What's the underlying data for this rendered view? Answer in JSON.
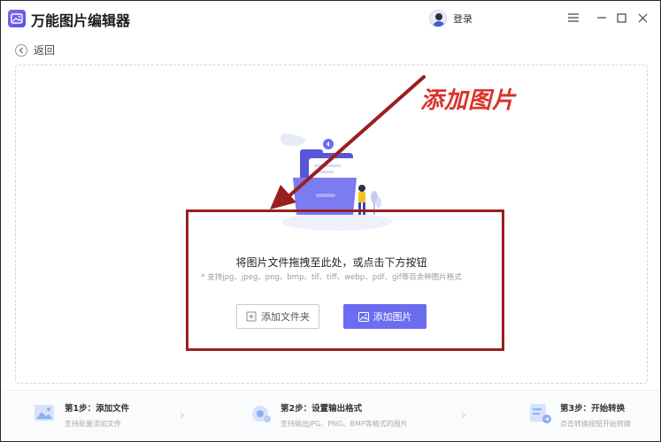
{
  "app": {
    "title": "万能图片编辑器"
  },
  "header": {
    "login_label": "登录"
  },
  "nav": {
    "back_label": "返回"
  },
  "annotation": {
    "label": "添加图片",
    "color": "#d8342c",
    "box_color": "#9a1f1f"
  },
  "dropzone": {
    "title": "将图片文件拖拽至此处，或点击下方按钮",
    "formats": "* 支持jpg、jpeg、png、bmp、tif、tiff、webp、pdf、gif等百余种图片格式"
  },
  "buttons": {
    "add_folder": "添加文件夹",
    "add_image": "添加图片"
  },
  "steps": [
    {
      "title": "第1步：添加文件",
      "desc": "支持批量添加文件",
      "icon": "image-upload-icon"
    },
    {
      "title": "第2步：设置输出格式",
      "desc": "支持输出JPG、PNG、BMP等格式的图片",
      "icon": "gear-icon"
    },
    {
      "title": "第3步：开始转换",
      "desc": "点击转换按钮开始转换",
      "icon": "convert-icon"
    }
  ],
  "colors": {
    "accent": "#6c6cf0",
    "brand": "#6a5ce8"
  }
}
